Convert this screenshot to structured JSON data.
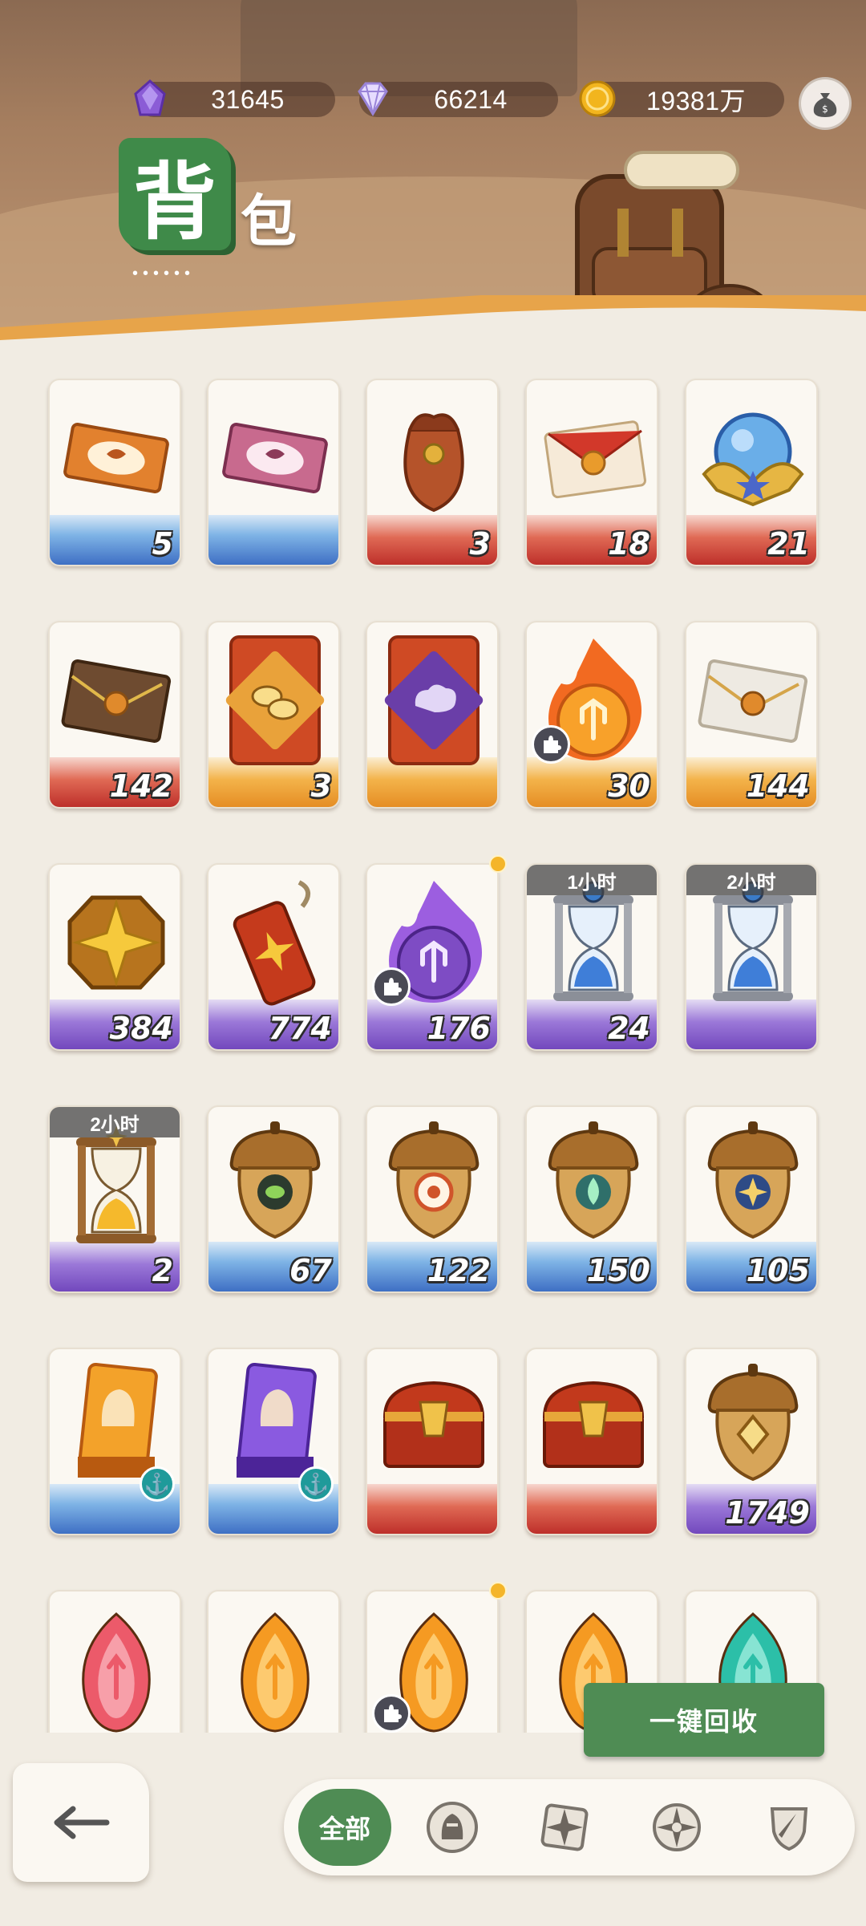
{
  "currencies": [
    {
      "name": "purple-crystal",
      "value": "31645",
      "color": "#8b5cd6"
    },
    {
      "name": "diamond",
      "value": "66214",
      "color": "#c8b6f0"
    },
    {
      "name": "gold-coin",
      "value": "19381万",
      "color": "#f2b51e"
    }
  ],
  "title": {
    "main": "背",
    "sub": "包",
    "dots": "••••••"
  },
  "items": [
    {
      "icon": "ticket-orange-icon",
      "count": "5",
      "band": "blue"
    },
    {
      "icon": "ticket-pink-icon",
      "count": "",
      "band": "blue"
    },
    {
      "icon": "pouch-icon",
      "count": "3",
      "band": "red"
    },
    {
      "icon": "letter-red-icon",
      "count": "18",
      "band": "red"
    },
    {
      "icon": "crystal-orb-icon",
      "count": "21",
      "band": "red"
    },
    {
      "icon": "envelope-brown-icon",
      "count": "142",
      "band": "red"
    },
    {
      "icon": "red-envelope-coins-icon",
      "count": "3",
      "band": "orange"
    },
    {
      "icon": "red-envelope-cloud-icon",
      "count": "",
      "band": "orange"
    },
    {
      "icon": "fire-orb-icon",
      "count": "30",
      "band": "orange",
      "puzzle": true
    },
    {
      "icon": "envelope-white-icon",
      "count": "144",
      "band": "orange"
    },
    {
      "icon": "star-medal-icon",
      "count": "384",
      "band": "purple"
    },
    {
      "icon": "firecracker-icon",
      "count": "774",
      "band": "purple"
    },
    {
      "icon": "purple-flame-orb-icon",
      "count": "176",
      "band": "purple",
      "puzzle": true,
      "dot": true
    },
    {
      "icon": "hourglass-blue-icon",
      "count": "24",
      "band": "purple",
      "tag": "1小时"
    },
    {
      "icon": "hourglass-blue-icon",
      "count": "",
      "band": "purple",
      "tag": "2小时"
    },
    {
      "icon": "hourglass-gold-icon",
      "count": "2",
      "band": "purple",
      "tag": "2小时"
    },
    {
      "icon": "acorn-eye-icon",
      "count": "67",
      "band": "blue"
    },
    {
      "icon": "acorn-target-icon",
      "count": "122",
      "band": "blue"
    },
    {
      "icon": "acorn-leaf-icon",
      "count": "150",
      "band": "blue"
    },
    {
      "icon": "acorn-star-icon",
      "count": "105",
      "band": "blue"
    },
    {
      "icon": "card-gold-helmet-icon",
      "count": "",
      "band": "blue",
      "anchor": true
    },
    {
      "icon": "card-purple-helmet-icon",
      "count": "",
      "band": "blue",
      "anchor": true
    },
    {
      "icon": "chest-red-icon",
      "count": "",
      "band": "red"
    },
    {
      "icon": "chest-red-icon",
      "count": "",
      "band": "red"
    },
    {
      "icon": "acorn-diamond-icon",
      "count": "1749",
      "band": "purple"
    },
    {
      "icon": "seed-red-icon",
      "count": "",
      "band": "none"
    },
    {
      "icon": "seed-orange-icon",
      "count": "",
      "band": "none"
    },
    {
      "icon": "seed-orange-icon",
      "count": "",
      "band": "none",
      "puzzle": true,
      "dot": true
    },
    {
      "icon": "seed-orange-icon",
      "count": "",
      "band": "none"
    },
    {
      "icon": "seed-teal-icon",
      "count": "",
      "band": "none"
    }
  ],
  "actions": {
    "recycle": "一键回收"
  },
  "tabs": {
    "all": "全部",
    "icons": [
      "knight-helmet-icon",
      "compass-star-icon",
      "shield-compass-icon",
      "sword-shield-icon"
    ]
  }
}
